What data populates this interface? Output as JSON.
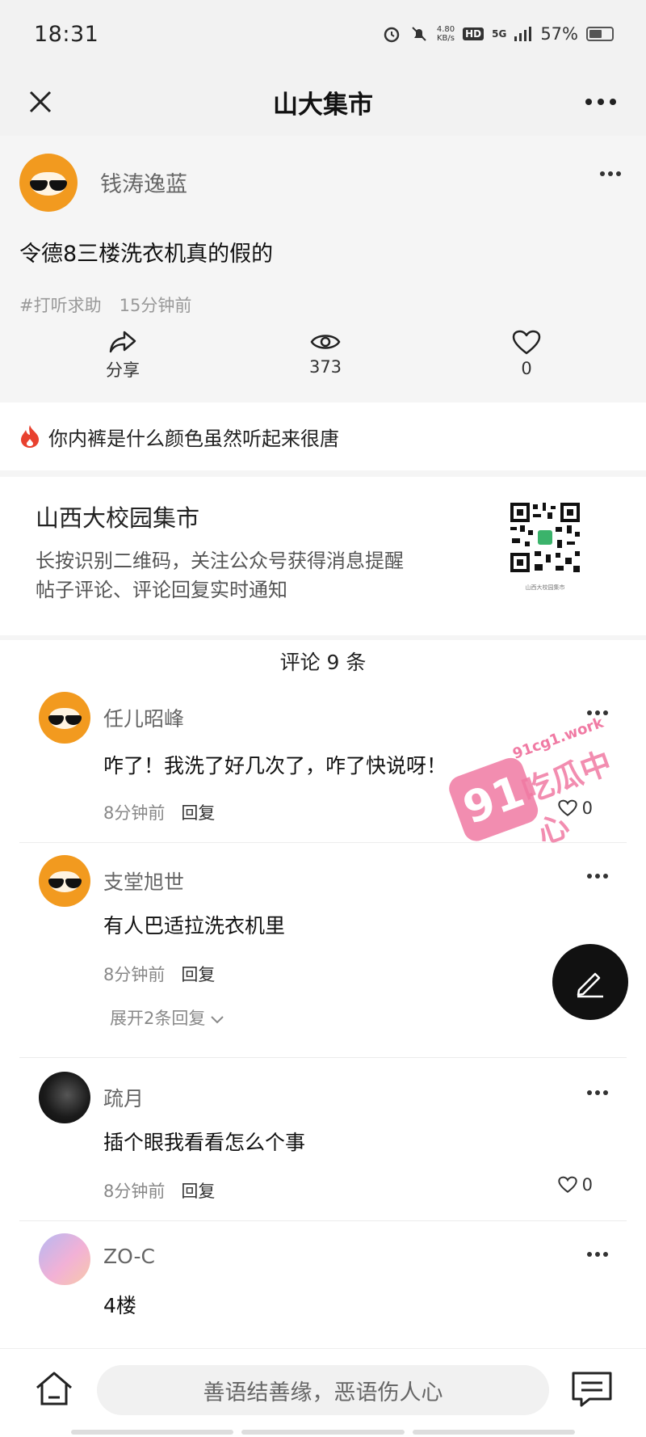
{
  "status": {
    "time": "18:31",
    "net_speed_top": "4.80",
    "net_speed_unit": "KB/s",
    "hd_label": "HD",
    "network_label": "5G",
    "battery_percent": "57%",
    "battery_fraction": 0.57
  },
  "header": {
    "title": "山大集市"
  },
  "post": {
    "author": "钱涛逸蓝",
    "title": "令德8三楼洗衣机真的假的",
    "tag": "#打听求助",
    "time": "15分钟前",
    "share_label": "分享",
    "views": "373",
    "likes": "0"
  },
  "hot": {
    "text": "你内裤是什么颜色虽然听起来很唐"
  },
  "promo": {
    "title": "山西大校园集市",
    "line1": "长按识别二维码，关注公众号获得消息提醒",
    "line2": "帖子评论、评论回复实时通知",
    "qr_caption": "山西大校园集市"
  },
  "comments_header": "评论 9 条",
  "comments": [
    {
      "name": "任儿昭峰",
      "text": "咋了！我洗了好几次了，咋了快说呀！",
      "time": "8分钟前",
      "reply": "回复",
      "likes": "0"
    },
    {
      "name": "支堂旭世",
      "text": "有人巴适拉洗衣机里",
      "time": "8分钟前",
      "reply": "回复",
      "expand": "展开2条回复"
    },
    {
      "name": "疏月",
      "text": "插个眼我看看怎么个事",
      "time": "8分钟前",
      "reply": "回复",
      "likes": "0"
    },
    {
      "name": "ZO-C",
      "text": "4楼"
    }
  ],
  "watermark": {
    "badge": "91",
    "site": "91cg1.work",
    "text": "吃瓜中心"
  },
  "bottom": {
    "input_placeholder": "善语结善缘，恶语伤人心"
  },
  "icons": {
    "close": "close-icon",
    "more": "more-icon",
    "share": "share-icon",
    "views": "eye-icon",
    "like": "heart-icon",
    "flame": "flame-icon",
    "edit": "pencil-icon",
    "home": "home-icon",
    "chat": "chat-icon"
  },
  "colors": {
    "avatar_orange": "#f29a1f",
    "flame": "#e8412f",
    "watermark_pink": "#f07aa3"
  }
}
